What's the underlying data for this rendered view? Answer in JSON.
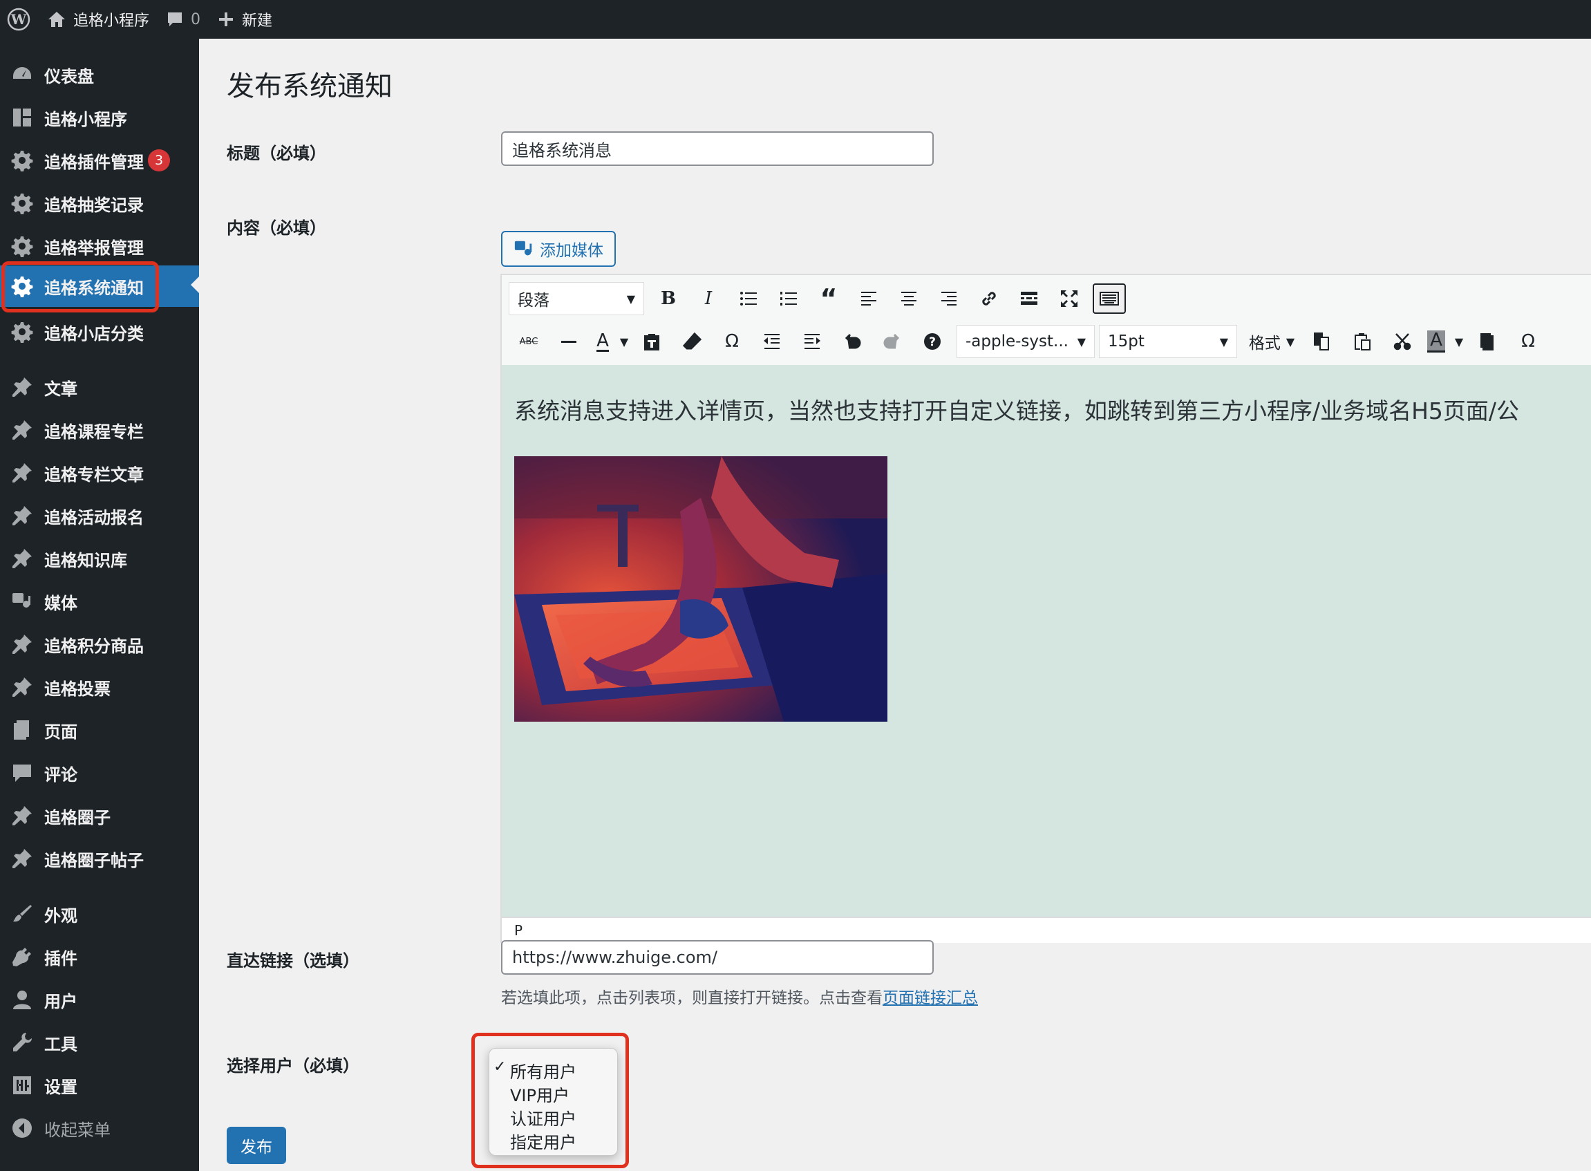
{
  "adminbar": {
    "site_name": "追格小程序",
    "comments_count": "0",
    "new_label": "新建"
  },
  "sidebar": {
    "items": [
      {
        "label": "仪表盘",
        "icon": "dashboard-icon"
      },
      {
        "label": "追格小程序",
        "icon": "grid-icon"
      },
      {
        "label": "追格插件管理",
        "icon": "gear-icon",
        "badge": "3"
      },
      {
        "label": "追格抽奖记录",
        "icon": "gear-icon"
      },
      {
        "label": "追格举报管理",
        "icon": "gear-icon"
      },
      {
        "label": "追格系统通知",
        "icon": "gear-icon",
        "active": true
      },
      {
        "label": "追格小店分类",
        "icon": "gear-icon"
      },
      {
        "label": "文章",
        "icon": "pin-icon"
      },
      {
        "label": "追格课程专栏",
        "icon": "pin-icon"
      },
      {
        "label": "追格专栏文章",
        "icon": "pin-icon"
      },
      {
        "label": "追格活动报名",
        "icon": "pin-icon"
      },
      {
        "label": "追格知识库",
        "icon": "pin-icon"
      },
      {
        "label": "媒体",
        "icon": "media-icon"
      },
      {
        "label": "追格积分商品",
        "icon": "pin-icon"
      },
      {
        "label": "追格投票",
        "icon": "pin-icon"
      },
      {
        "label": "页面",
        "icon": "page-icon"
      },
      {
        "label": "评论",
        "icon": "comment-icon"
      },
      {
        "label": "追格圈子",
        "icon": "pin-icon"
      },
      {
        "label": "追格圈子帖子",
        "icon": "pin-icon"
      },
      {
        "label": "外观",
        "icon": "brush-icon"
      },
      {
        "label": "插件",
        "icon": "plugin-icon"
      },
      {
        "label": "用户",
        "icon": "user-icon"
      },
      {
        "label": "工具",
        "icon": "wrench-icon"
      },
      {
        "label": "设置",
        "icon": "settings-icon"
      },
      {
        "label": "收起菜单",
        "icon": "collapse-icon"
      }
    ]
  },
  "page": {
    "title": "发布系统通知",
    "title_label": "标题（必填）",
    "title_value": "追格系统消息",
    "content_label": "内容（必填）",
    "add_media": "添加媒体",
    "link_label": "直达链接（选填）",
    "link_value": "https://www.zhuige.com/",
    "hint_text": "若选填此项，点击列表项，则直接打开链接。点击查看",
    "hint_link": "页面链接汇总",
    "user_label": "选择用户（必填）",
    "publish": "发布"
  },
  "editor": {
    "format_select": "段落",
    "font_select": "-apple-syst...",
    "size_select": "15pt",
    "styles_select": "格式",
    "content_text": "系统消息支持进入详情页，当然也支持打开自定义链接，如跳转到第三方小程序/业务域名H5页面/公",
    "status_path": "P",
    "content_bg": "#d5e5df"
  },
  "user_select": {
    "options": [
      "所有用户",
      "VIP用户",
      "认证用户",
      "指定用户"
    ],
    "selected": "所有用户"
  },
  "colors": {
    "accent": "#2271b1",
    "highlight": "#e0301e",
    "badge": "#d63638"
  }
}
